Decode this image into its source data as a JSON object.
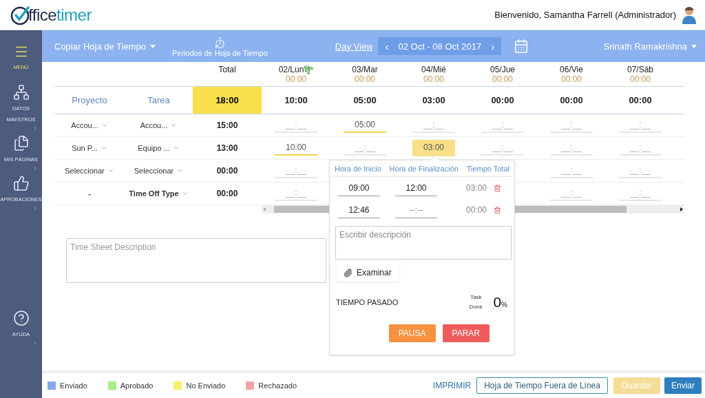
{
  "header": {
    "logo": {
      "lead": "ffice",
      "accent": "timer"
    },
    "welcome": "Bienvenido, Samantha Farrell (Administrador)"
  },
  "sidebar": {
    "items": [
      {
        "kind": "menu",
        "label": "MENÚ",
        "selected": true,
        "submenu": false
      },
      {
        "kind": "hierarchy",
        "label": "DATOS MAESTROS",
        "selected": false,
        "submenu": true
      },
      {
        "kind": "pages",
        "label": "MIS PÁGINAS",
        "selected": false,
        "submenu": true
      },
      {
        "kind": "approvals",
        "label": "APROBACIONES",
        "selected": false,
        "submenu": true
      },
      {
        "kind": "help",
        "label": "AYUDA",
        "selected": false,
        "submenu": true
      }
    ]
  },
  "toolbar": {
    "copy": "Copiar Hoja de Tiempo",
    "periods": "Periodos de Hoja de Tiempo",
    "day_view": "Day View",
    "prev": "‹",
    "date_range": "02 Oct - 08 Oct 2017",
    "next": "›",
    "user": "Srinath Ramakrishna"
  },
  "grid": {
    "total_label": "Total",
    "days": [
      {
        "label": "02/Lun",
        "total": "00:00",
        "holiday": true
      },
      {
        "label": "03/Mar",
        "total": "00:00",
        "holiday": false
      },
      {
        "label": "04/Mié",
        "total": "00:00",
        "holiday": false
      },
      {
        "label": "05/Jue",
        "total": "00:00",
        "holiday": false
      },
      {
        "label": "06/Vie",
        "total": "00:00",
        "holiday": false
      },
      {
        "label": "07/Sáb",
        "total": "00:00",
        "holiday": false
      }
    ],
    "summary": {
      "project_label": "Proyecto",
      "task_label": "Tarea",
      "total": "18:00",
      "days": [
        "10:00",
        "05:00",
        "03:00",
        "00:00",
        "00:00",
        "00:00"
      ]
    },
    "rows": [
      {
        "kind": "project",
        "project": "Accou...",
        "task": "Accou...",
        "total": "15:00",
        "cells": [
          {
            "placeholder": "__:__",
            "selected": false
          },
          {
            "value": "05:00",
            "selected": false
          },
          {
            "placeholder": "__:__",
            "selected": false
          },
          {
            "placeholder": "__:__",
            "selected": false
          },
          {
            "placeholder": "__:__",
            "selected": false
          },
          {
            "placeholder": "__:__",
            "selected": false
          }
        ]
      },
      {
        "kind": "project",
        "project": "Sun P...",
        "task": "Equipo ...",
        "total": "13:00",
        "cells": [
          {
            "value": "10:00",
            "selected": false
          },
          {
            "placeholder": "__:__",
            "selected": false
          },
          {
            "value": "03:00",
            "selected": true
          },
          {
            "placeholder": "__:__",
            "selected": false
          },
          {
            "placeholder": "__:__",
            "selected": false
          },
          {
            "placeholder": "__:__",
            "selected": false
          }
        ]
      },
      {
        "kind": "project",
        "project": "Seleccionar",
        "task": "Seleccionar",
        "total": "00:00",
        "cells": [
          {
            "placeholder": "__:__",
            "selected": false
          },
          null,
          null,
          null,
          {
            "placeholder": "__:__",
            "selected": false
          },
          {
            "placeholder": "__:__",
            "selected": false
          }
        ]
      },
      {
        "kind": "time_off",
        "project": "-",
        "task": "Time Off Type",
        "total": "00:00",
        "cells": [
          {
            "placeholder": "__:__",
            "selected": false
          },
          null,
          null,
          null,
          {
            "placeholder": "__:__",
            "selected": false
          },
          {
            "placeholder": "__:__",
            "selected": false
          }
        ]
      }
    ]
  },
  "description": {
    "placeholder": "Time Sheet Description"
  },
  "popup": {
    "headers": [
      "Hora de Inicio",
      "Hora de Finalización",
      "Tiempo Total"
    ],
    "entries": [
      {
        "start": "09:00",
        "end": "12:00",
        "total": "03:00"
      },
      {
        "start": "12:46",
        "end_placeholder": "--:--",
        "total": "00:00"
      }
    ],
    "description_placeholder": "Escribir descripción",
    "browse": "Examinar",
    "elapsed_label": "TIEMPO PASADO",
    "task_done_label": "Task Done",
    "percent": "0",
    "percent_sign": "%",
    "pause": "PAUSA",
    "stop": "PARAR"
  },
  "footer": {
    "legend": [
      {
        "label": "Enviado",
        "color": "#86a9ee"
      },
      {
        "label": "Aprobado",
        "color": "#a6ee86"
      },
      {
        "label": "No Enviado",
        "color": "#f5f06a"
      },
      {
        "label": "Rechazado",
        "color": "#f3a3a3"
      }
    ],
    "print": "IMPRIMIR",
    "offline": "Hoja de Tiempo Fuera de Línea",
    "save": {
      "label": "Guardar",
      "disabled": true
    },
    "submit": "Enviar"
  }
}
